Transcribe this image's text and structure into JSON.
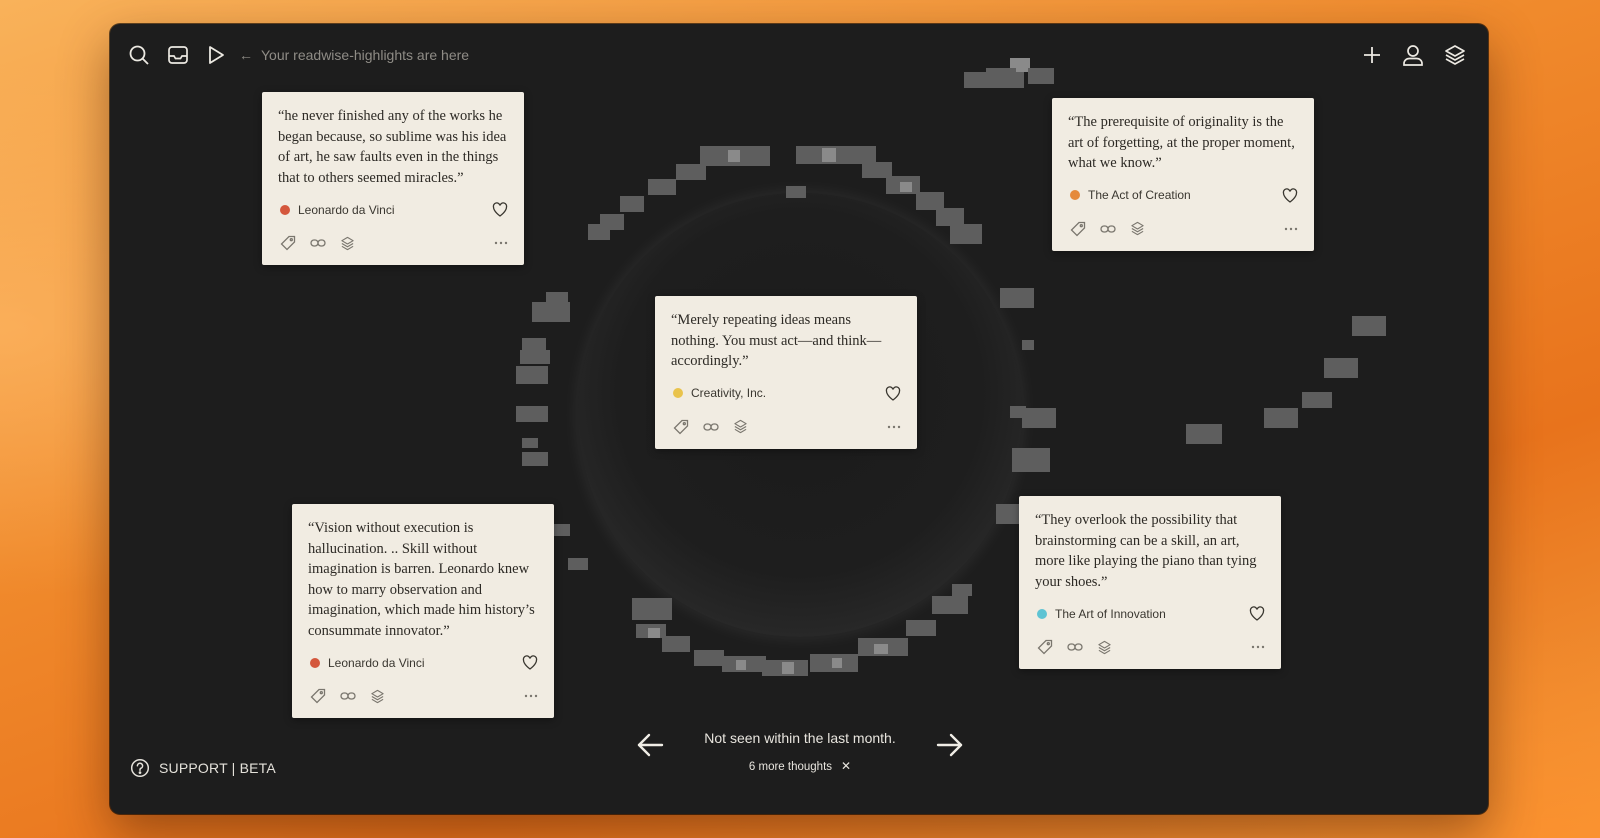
{
  "topbar": {
    "left_icons": [
      "search-icon",
      "inbox-icon",
      "play-icon"
    ],
    "hint_arrow": "←",
    "hint_text": "Your readwise-highlights are here",
    "right_icons": [
      "plus-icon",
      "user-icon",
      "layers-icon"
    ]
  },
  "cards": [
    {
      "quote": "“he never finished any of the works he began because, so sublime was his idea of art, he saw faults even in the things that to others seemed miracles.”",
      "source": "Leonardo da Vinci",
      "dot_color": "#d4573c"
    },
    {
      "quote": "“The prerequisite of originality is the art of forgetting, at the proper moment, what we know.”",
      "source": "The Act of Creation",
      "dot_color": "#e58a3c"
    },
    {
      "quote": "“Merely repeating ideas means nothing. You must act—and think—accordingly.”",
      "source": "Creativity, Inc.",
      "dot_color": "#e9c34c"
    },
    {
      "quote": "“Vision without execution is hallucination. .. Skill without imagination is barren. Leonardo knew how to marry observation and imagination, which made him history’s consummate innovator.”",
      "source": "Leonardo da Vinci",
      "dot_color": "#d4573c"
    },
    {
      "quote": "“They overlook the possibility that brainstorming can be a skill, an art, more like playing the piano than tying your shoes.”",
      "source": "The Art of Innovation",
      "dot_color": "#5ec3d3"
    }
  ],
  "card_action_icons": [
    "tag-icon",
    "link-icon",
    "layers-icon",
    "more-icon"
  ],
  "bottom": {
    "status": "Not seen within the last month.",
    "more_thoughts": "6 more thoughts",
    "close_glyph": "✕"
  },
  "support": {
    "label": "SUPPORT | BETA"
  },
  "colors": {
    "window_bg": "#1d1d1d",
    "card_bg": "#f1ece2",
    "desktop_orange": "#f08a2c"
  }
}
